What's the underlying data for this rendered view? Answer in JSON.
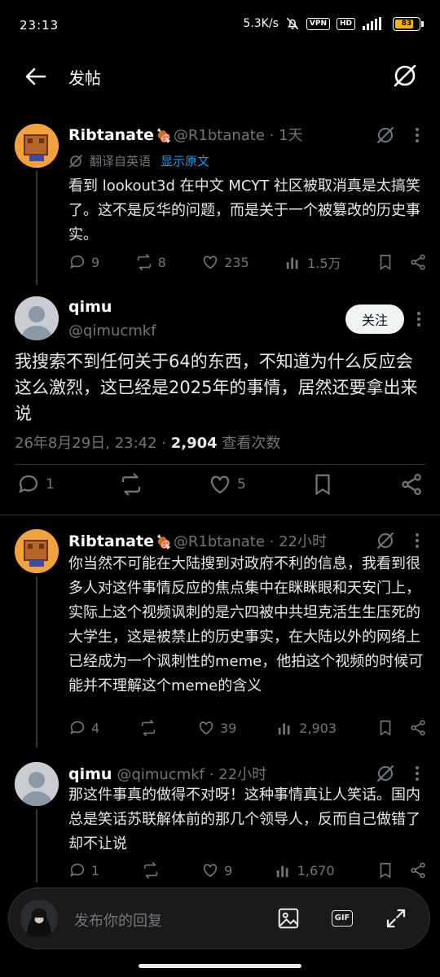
{
  "status_bar": {
    "time": "23:13",
    "speed": "5.3K/s",
    "vpn": "VPN",
    "hd": "HD",
    "battery": "83"
  },
  "header": {
    "title": "发帖"
  },
  "tweets": [
    {
      "display_name": "Ribtanate",
      "emoji": "🍖",
      "handle": "@R1btanate · 1天",
      "translated_label": "翻译自英语",
      "show_original": "显示原文",
      "text": "看到 lookout3d 在中文 MCYT 社区被取消真是太搞笑了。这不是反华的问题，而是关于一个被篡改的历史事实。",
      "replies": "9",
      "reposts": "8",
      "likes": "235",
      "views": "1.5万"
    },
    {
      "display_name": "qimu",
      "handle": "@qimucmkf",
      "follow_label": "关注",
      "text": "我搜索不到任何关于64的东西，不知道为什么反应会这么激烈，这已经是2025年的事情，居然还要拿出来说",
      "timestamp": "26年8月29日, 23:42 · ",
      "view_count": "2,904",
      "view_label": " 查看次数",
      "replies": "1",
      "likes": "5"
    },
    {
      "display_name": "Ribtanate",
      "emoji": "🍖",
      "handle": "@R1btanate · 22小时",
      "text": "你当然不可能在大陆搜到对政府不利的信息，我看到很多人对这件事情反应的焦点集中在眯眯眼和天安门上，实际上这个视频讽刺的是六四被中共坦克活生生压死的大学生，这是被禁止的历史事实，在大陆以外的网络上已经成为一个讽刺性的meme，他拍这个视频的时候可能并不理解这个meme的含义",
      "replies": "4",
      "likes": "39",
      "views": "2,903"
    },
    {
      "display_name": "qimu",
      "handle": "@qimucmkf · 22小时",
      "text": "那这件事真的做得不对呀！这种事情真让人笑话。国内总是笑话苏联解体前的那几个领导人，反而自己做错了却不让说",
      "replies": "1",
      "likes": "9",
      "views": "1,670"
    }
  ],
  "reply_bar": {
    "placeholder": "发布你的回复",
    "gif": "GIF"
  }
}
